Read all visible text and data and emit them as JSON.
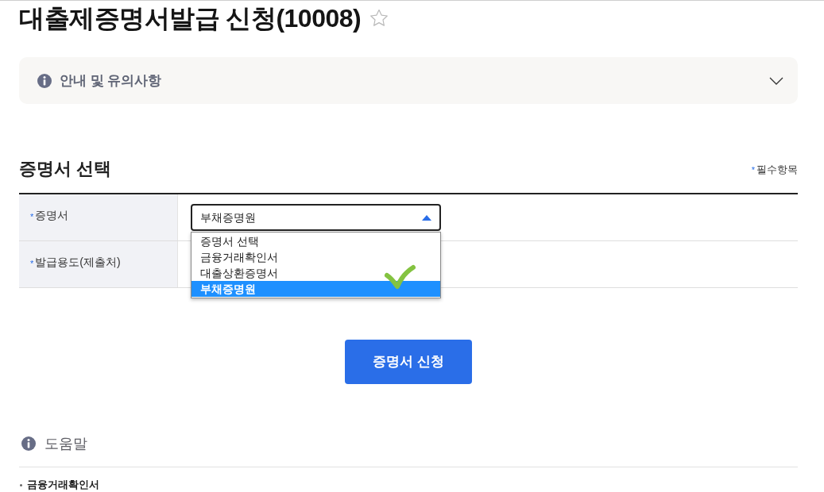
{
  "page": {
    "title": "대출제증명서발급 신청(10008)",
    "favorite": false
  },
  "notice": {
    "title": "안내 및 유의사항",
    "expanded": false
  },
  "section": {
    "title": "증명서 선택",
    "required_note": {
      "mark": "*",
      "text": "필수항목"
    }
  },
  "form": {
    "rows": [
      {
        "mark": "*",
        "label": "증명서",
        "select": {
          "value": "부채증명원",
          "expanded": true,
          "options": [
            {
              "label": "증명서 선택",
              "selected": false
            },
            {
              "label": "금융거래확인서",
              "selected": false
            },
            {
              "label": "대출상환증명서",
              "selected": false
            },
            {
              "label": "부채증명원",
              "selected": true
            }
          ]
        }
      },
      {
        "mark": "*",
        "label": "발급용도(제출처)"
      }
    ]
  },
  "submit_button": {
    "label": "증명서 신청"
  },
  "help": {
    "title": "도움말",
    "items": [
      {
        "text": "금융거래확인서"
      }
    ]
  }
}
